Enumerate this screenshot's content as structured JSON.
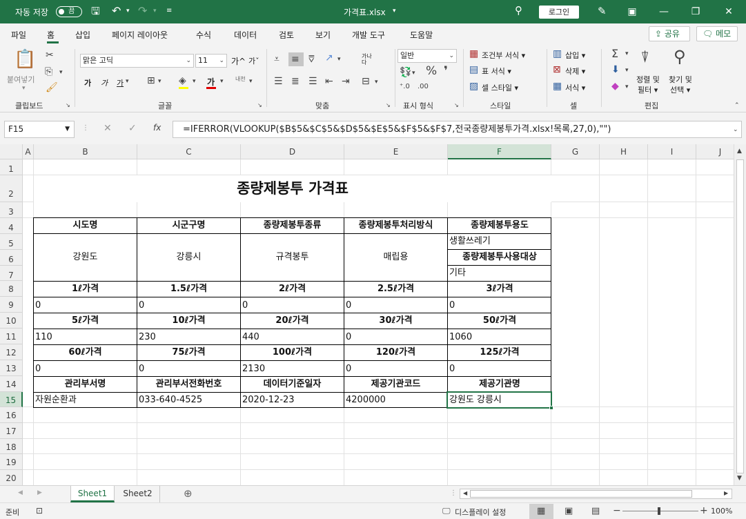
{
  "titlebar": {
    "autosave": "자동 저장",
    "autosave_state": "끔",
    "filename": "가격표.xlsx",
    "login": "로그인"
  },
  "menu_tabs": [
    "파일",
    "홈",
    "삽입",
    "페이지 레이아웃",
    "수식",
    "데이터",
    "검토",
    "보기",
    "개발 도구",
    "도움말"
  ],
  "share_label": "공유",
  "memo_label": "메모",
  "ribbon": {
    "clipboard": {
      "paste": "붙여넣기",
      "label": "클립보드"
    },
    "font": {
      "name": "맑은 고딕",
      "size": "11",
      "bold": "가",
      "italic": "가",
      "underline": "가",
      "label": "글꼴",
      "grow": "가^",
      "shrink": "가ˇ",
      "phonetic": "내천"
    },
    "alignment": {
      "label": "맞춤",
      "wrap": "가나",
      "merge": "다"
    },
    "number": {
      "format": "일반",
      "label": "표시 형식"
    },
    "styles": {
      "conditional": "조건부 서식",
      "table": "표 서식",
      "cell": "셀 스타일",
      "label": "스타일"
    },
    "cells": {
      "insert": "삽입",
      "delete": "삭제",
      "format": "서식",
      "label": "셀"
    },
    "editing": {
      "sort": "정렬 및",
      "sort2": "필터",
      "find": "찾기 및",
      "find2": "선택",
      "label": "편집"
    }
  },
  "namebox": "F15",
  "formula": "=IFERROR(VLOOKUP($B$5&$C$5&$D$5&$E$5&$F$5&$F$7,전국종량제봉투가격.xlsx!목록,27,0),\"\")",
  "columns": [
    "A",
    "B",
    "C",
    "D",
    "E",
    "F",
    "G",
    "H",
    "I",
    "J"
  ],
  "rows": [
    "1",
    "2",
    "3",
    "4",
    "5",
    "6",
    "7",
    "8",
    "9",
    "10",
    "11",
    "12",
    "13",
    "14",
    "15",
    "16",
    "17",
    "18",
    "19",
    "20"
  ],
  "sheet": {
    "title": "종량제봉투 가격표",
    "r4": [
      "시도명",
      "시군구명",
      "종량제봉투종류",
      "종량제봉투처리방식",
      "종량제봉투용도"
    ],
    "r5_7": {
      "b": "강원도",
      "c": "강릉시",
      "d": "규격봉투",
      "e": "매립용",
      "f5": "생활쓰레기",
      "f6": "종량제봉투사용대상",
      "f7": "기타"
    },
    "r8": [
      "1ℓ가격",
      "1.5ℓ가격",
      "2ℓ가격",
      "2.5ℓ가격",
      "3ℓ가격"
    ],
    "r9": [
      "0",
      "0",
      "0",
      "0",
      "0"
    ],
    "r10": [
      "5ℓ가격",
      "10ℓ가격",
      "20ℓ가격",
      "30ℓ가격",
      "50ℓ가격"
    ],
    "r11": [
      "110",
      "230",
      "440",
      "0",
      "1060"
    ],
    "r12": [
      "60ℓ가격",
      "75ℓ가격",
      "100ℓ가격",
      "120ℓ가격",
      "125ℓ가격"
    ],
    "r13": [
      "0",
      "0",
      "2130",
      "0",
      "0"
    ],
    "r14": [
      "관리부서명",
      "관리부서전화번호",
      "데이터기준일자",
      "제공기관코드",
      "제공기관명"
    ],
    "r15": [
      "자원순환과",
      "033-640-4525",
      "2020-12-23",
      "4200000",
      "강원도 강릉시"
    ]
  },
  "sheet_tabs": [
    "Sheet1",
    "Sheet2"
  ],
  "status": {
    "ready": "준비",
    "display": "디스플레이 설정",
    "zoom": "100%"
  }
}
